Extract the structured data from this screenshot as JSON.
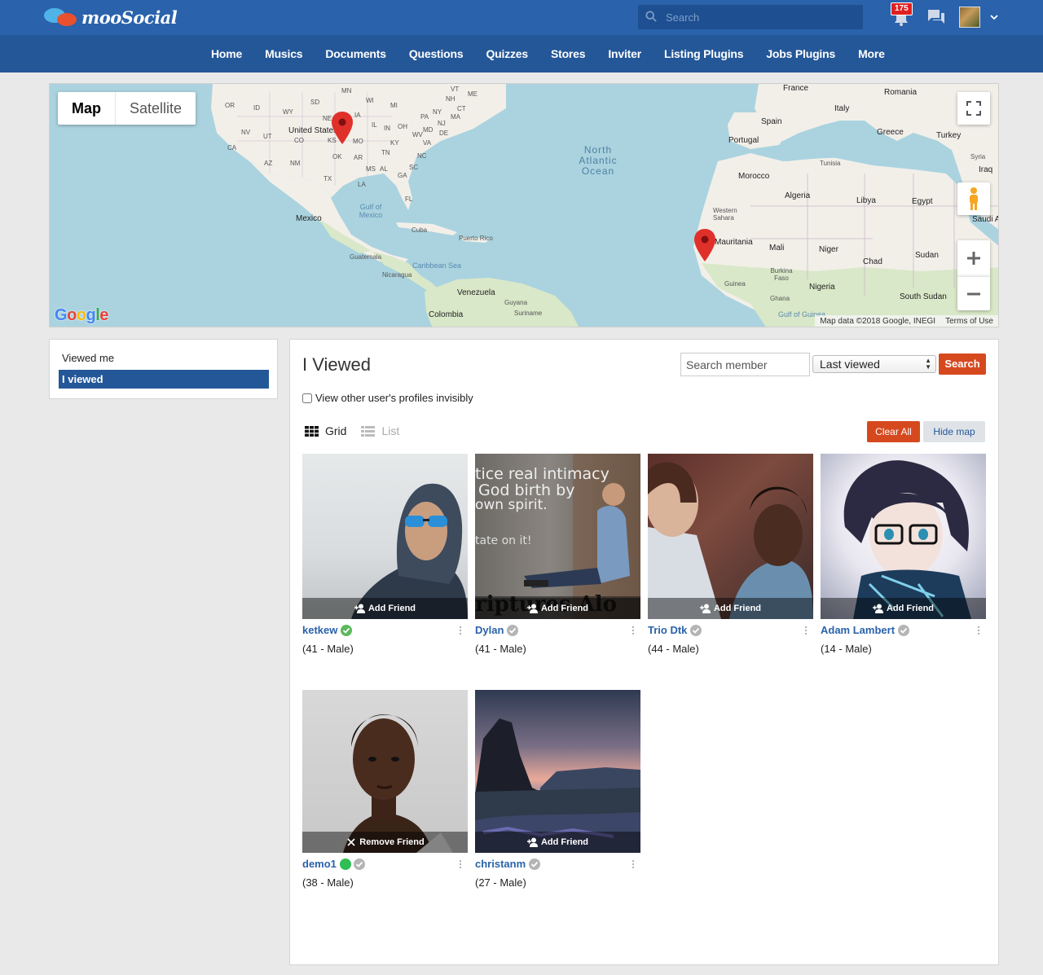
{
  "app": {
    "logo_text": "mooSocial"
  },
  "topbar": {
    "search_placeholder": "Search",
    "notification_count": "175"
  },
  "nav": {
    "items": [
      "Home",
      "Musics",
      "Documents",
      "Questions",
      "Quizzes",
      "Stores",
      "Inviter",
      "Listing Plugins",
      "Jobs Plugins",
      "More"
    ]
  },
  "map": {
    "type_buttons": [
      "Map",
      "Satellite"
    ],
    "active_type": "Map",
    "google_label": "Google",
    "attribution": "Map data ©2018 Google, INEGI",
    "terms": "Terms of Use",
    "labels": {
      "us": "United States",
      "mexico": "Mexico",
      "cuba": "Cuba",
      "puerto_rico": "Puerto Rico",
      "guatemala": "Guatemala",
      "nicaragua": "Nicaragua",
      "caribbean": "Caribbean Sea",
      "gulf": "Gulf of Mexico",
      "venezuela": "Venezuela",
      "colombia": "Colombia",
      "guyana": "Guyana",
      "suriname": "Suriname",
      "ocean": "North Atlantic Ocean",
      "france": "France",
      "italy": "Italy",
      "spain": "Spain",
      "portugal": "Portugal",
      "romania": "Romania",
      "greece": "Greece",
      "turkey": "Turkey",
      "syria": "Syria",
      "iraq": "Iraq",
      "tunisia": "Tunisia",
      "morocco": "Morocco",
      "algeria": "Algeria",
      "libya": "Libya",
      "egypt": "Egypt",
      "western_sahara": "Western Sahara",
      "mauritania": "Mauritania",
      "mali": "Mali",
      "niger": "Niger",
      "chad": "Chad",
      "sudan": "Sudan",
      "south_sudan": "South Sudan",
      "burkina": "Burkina Faso",
      "guinea": "Guinea",
      "ghana": "Ghana",
      "nigeria": "Nigeria",
      "gulf_guinea": "Gulf of Guinea",
      "saudi": "Saudi A"
    },
    "state_codes": [
      "MN",
      "WI",
      "MI",
      "SD",
      "ID",
      "WY",
      "NE",
      "IA",
      "IL",
      "IN",
      "OH",
      "PA",
      "NY",
      "NV",
      "UT",
      "CO",
      "KS",
      "MO",
      "KY",
      "WV",
      "VA",
      "MD",
      "CA",
      "OK",
      "AR",
      "TN",
      "NC",
      "AZ",
      "NM",
      "MS",
      "AL",
      "GA",
      "SC",
      "TX",
      "LA",
      "FL",
      "OR",
      "ME",
      "NH",
      "VT",
      "MA",
      "NJ",
      "DE",
      "CT"
    ]
  },
  "sidebar": {
    "items": [
      {
        "label": "Viewed me",
        "active": false
      },
      {
        "label": "I viewed",
        "active": true
      }
    ]
  },
  "main": {
    "title": "I Viewed",
    "member_search_placeholder": "Search member",
    "sort_selected": "Last viewed",
    "search_button": "Search",
    "invisible_checkbox_label": "View other user's profiles invisibly",
    "invisible_checked": false,
    "view_grid_label": "Grid",
    "view_list_label": "List",
    "clear_all_button": "Clear All",
    "hide_map_button": "Hide map"
  },
  "members": [
    {
      "name": "ketkew",
      "meta": "(41 - Male)",
      "action": "Add Friend",
      "verified": true,
      "online": false
    },
    {
      "name": "Dylan",
      "meta": "(41 - Male)",
      "action": "Add Friend",
      "verified": false,
      "online": false
    },
    {
      "name": "Trio Dtk",
      "meta": "(44 - Male)",
      "action": "Add Friend",
      "verified": false,
      "online": false
    },
    {
      "name": "Adam Lambert",
      "meta": "(14 - Male)",
      "action": "Add Friend",
      "verified": false,
      "online": false
    },
    {
      "name": "demo1",
      "meta": "(38 - Male)",
      "action": "Remove Friend",
      "verified": false,
      "online": true
    },
    {
      "name": "christanm",
      "meta": "(27 - Male)",
      "action": "Add Friend",
      "verified": false,
      "online": false
    }
  ],
  "photo_text": {
    "dylan_lines": [
      "tice real intimacy",
      "God birth by",
      "own spirit.",
      "tate on it!",
      "riptures Alo"
    ]
  },
  "colors": {
    "topbar": "#2a62ab",
    "navbar": "#245798",
    "accent_orange": "#d6491f",
    "link_blue": "#2a62ab",
    "verified_green": "#5cb85c",
    "online_green": "#2fbf55",
    "map_water": "#aad3df",
    "map_land": "#f2efe9"
  },
  "icons": [
    "search-icon",
    "bell-icon",
    "chat-icon",
    "chevron-down-icon",
    "fullscreen-icon",
    "pegman-icon",
    "zoom-in-icon",
    "zoom-out-icon",
    "map-pin-icon",
    "grid-icon",
    "list-icon",
    "add-friend-icon",
    "remove-friend-icon",
    "verified-icon",
    "more-vertical-icon"
  ]
}
